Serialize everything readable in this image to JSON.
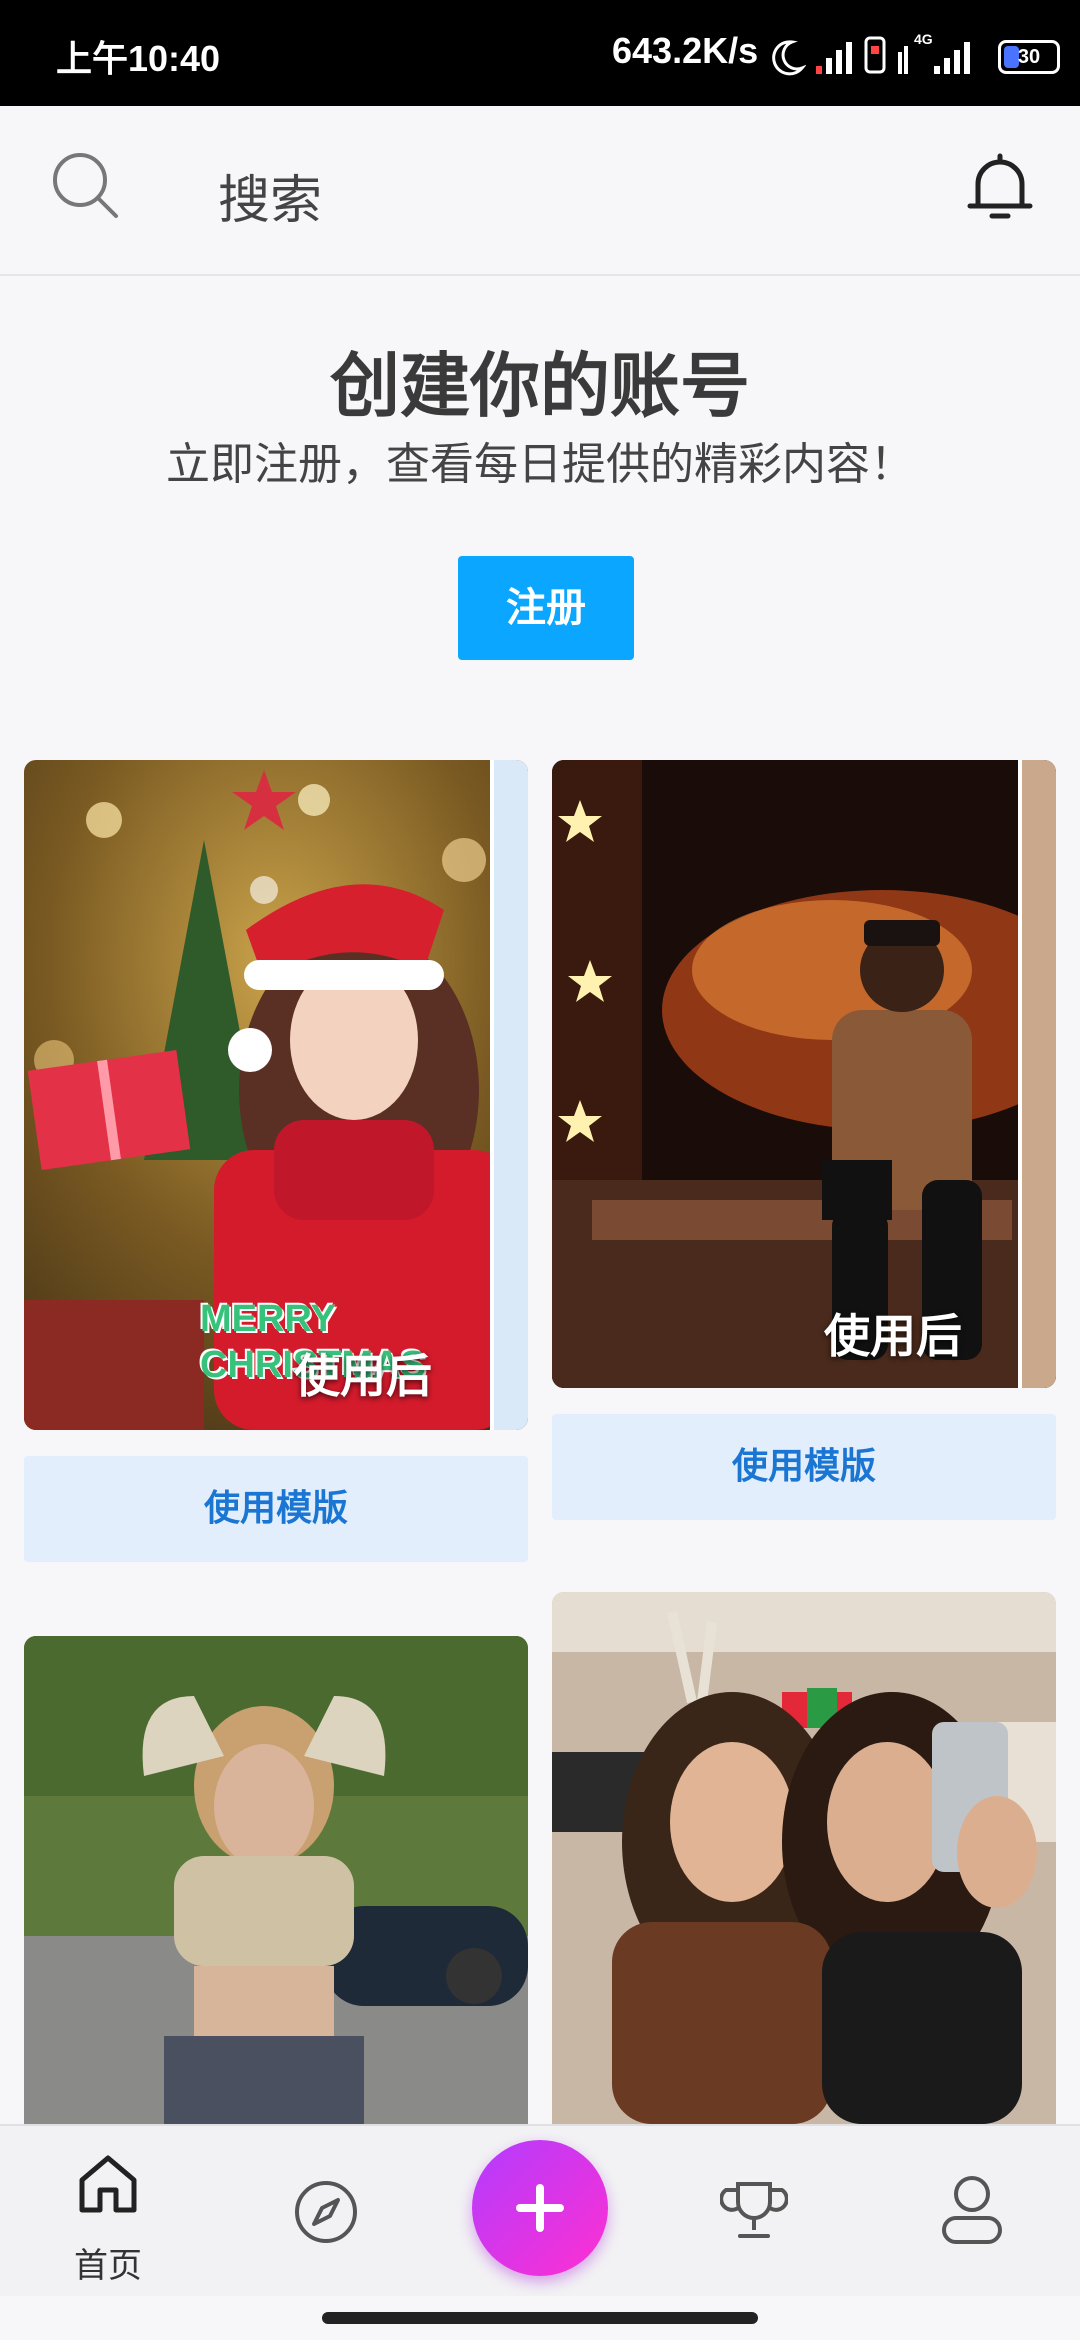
{
  "status_bar": {
    "time": "上午10:40",
    "net_speed": "643.2K/s",
    "battery_level": "30",
    "battery_fraction": 0.3,
    "network_type": "4G"
  },
  "header": {
    "search_label": "搜索"
  },
  "signup": {
    "title": "创建你的账号",
    "subtitle": "立即注册，查看每日提供的精彩内容！",
    "button_label": "注册"
  },
  "feed": {
    "cards": [
      {
        "after_label": "使用后",
        "caption": "MERRY CHRISTMAS",
        "button_label": "使用模版"
      },
      {
        "after_label": "使用后",
        "button_label": "使用模版"
      },
      {},
      {}
    ]
  },
  "bottom_nav": {
    "home_label": "首页"
  },
  "colors": {
    "accent": "#0aa6ff",
    "use_button_bg": "#e2eefc",
    "use_button_text": "#1a76d2",
    "fab_start": "#b23cff",
    "fab_end": "#ff2fd1"
  }
}
